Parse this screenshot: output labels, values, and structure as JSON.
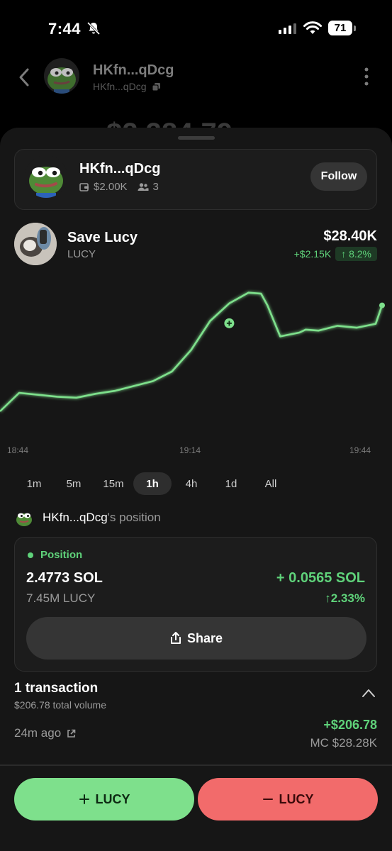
{
  "status_bar": {
    "time": "7:44",
    "battery": "71"
  },
  "header": {
    "name": "HKfn...qDcg",
    "subtitle": "HKfn...qDcg",
    "balance": "$2,384.79"
  },
  "trader": {
    "name": "HKfn...qDcg",
    "volume": "$2.00K",
    "followers": "3",
    "follow_label": "Follow"
  },
  "token": {
    "name": "Save Lucy",
    "ticker": "LUCY",
    "price": "$28.40K",
    "change_abs": "+$2.15K",
    "change_pct": "↑ 8.2%"
  },
  "chart_data": {
    "type": "line",
    "x_ticks": [
      "18:44",
      "19:14",
      "19:44"
    ],
    "x": [
      0,
      3,
      6,
      9,
      12,
      15,
      18,
      21,
      24,
      27,
      30,
      33,
      36,
      39,
      41,
      42,
      44,
      47,
      48,
      50,
      53,
      56,
      59,
      60
    ],
    "y": [
      17.5,
      19.4,
      19.2,
      19.0,
      18.9,
      19.3,
      19.6,
      20.1,
      20.6,
      21.6,
      23.8,
      26.8,
      28.6,
      29.7,
      29.6,
      28.4,
      25.2,
      25.6,
      25.9,
      25.8,
      26.3,
      26.1,
      26.5,
      28.4
    ],
    "marker_index": 12
  },
  "range_tabs": [
    "1m",
    "5m",
    "15m",
    "1h",
    "4h",
    "1d",
    "All"
  ],
  "range_active": "1h",
  "position": {
    "owner": "HKfn...qDcg",
    "suffix": "'s position",
    "label": "Position",
    "sol": "2.4773 SOL",
    "gain": "+ 0.0565 SOL",
    "qty": "7.45M LUCY",
    "pct": "↑2.33%",
    "share_label": "Share"
  },
  "transactions": {
    "title": "1 transaction",
    "volume": "$206.78 total volume",
    "time": "24m ago",
    "amount": "+$206.78",
    "mc": "MC $28.28K"
  },
  "actions": {
    "buy_label": "LUCY",
    "sell_label": "LUCY"
  },
  "colors": {
    "accent_green": "#5fd27a",
    "buy": "#7ee08c",
    "sell": "#f26b6b"
  }
}
